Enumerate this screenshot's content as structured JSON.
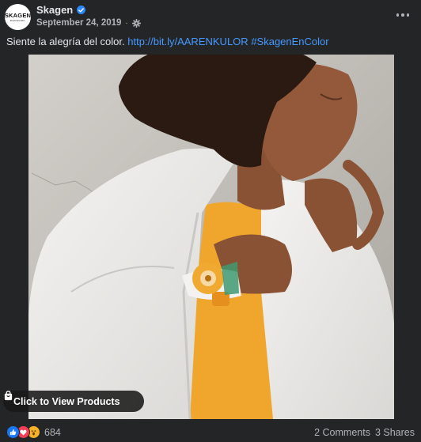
{
  "page": {
    "name": "Skagen",
    "avatar_text": "SKAGEN",
    "avatar_subtext": "DENMARK",
    "date": "September 24, 2019",
    "separator": "·"
  },
  "caption": {
    "text": "Siente la alegría del color.",
    "link": "http://bit.ly/AARENKULOR",
    "hashtag": "#SkagenEnColor"
  },
  "photo": {
    "products_button": "Click to View Products"
  },
  "footer": {
    "reaction_count": "684",
    "comments": "2 Comments",
    "shares": "3 Shares"
  },
  "colors": {
    "background": "#242526",
    "link": "#4599ff",
    "verified": "#2d88ff",
    "like": "#1877f2",
    "love": "#f33e58",
    "wow": "#f7b125"
  },
  "icons": {
    "verified": "verified-badge-icon",
    "privacy": "globe-gear-icon",
    "more": "more-horizontal-icon",
    "products": "shopping-bag-icon",
    "reactions": [
      "like-icon",
      "love-icon",
      "wow-icon"
    ]
  }
}
